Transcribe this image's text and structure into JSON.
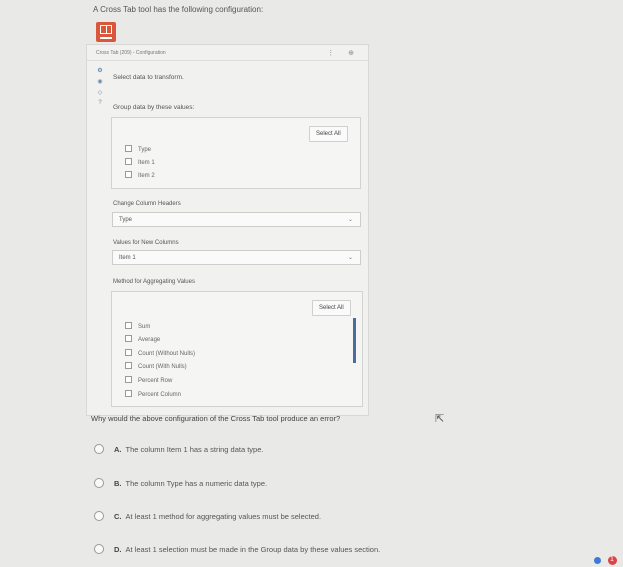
{
  "intro": "A Cross Tab tool has the following configuration:",
  "panel": {
    "header_title": "Cross Tab (209) - Configuration",
    "header_icons": "⋮ ⊕",
    "select_data_text": "Select data to transform.",
    "group_label": "Group data by these values:",
    "group_select_all": "Select All",
    "group_items": [
      "Type",
      "Item 1",
      "Item 2"
    ],
    "change_headers_label": "Change Column Headers",
    "change_headers_value": "Type",
    "new_columns_label": "Values for New Columns",
    "new_columns_value": "Item 1",
    "method_label": "Method for Aggregating Values",
    "method_select_all": "Select All",
    "methods": [
      "Sum",
      "Average",
      "Count (Without Nulls)",
      "Count (With Nulls)",
      "Percent Row",
      "Percent Column"
    ]
  },
  "question": "Why would the above configuration of the Cross Tab tool produce an error?",
  "options": [
    {
      "letter": "A.",
      "text": "The column Item 1 has a string data type."
    },
    {
      "letter": "B.",
      "text": "The column Type has a numeric data type."
    },
    {
      "letter": "C.",
      "text": "At least 1 method for aggregating values must be selected."
    },
    {
      "letter": "D.",
      "text": "At least 1 selection must be made in the Group data by these values section."
    }
  ],
  "tray_badge": "1"
}
